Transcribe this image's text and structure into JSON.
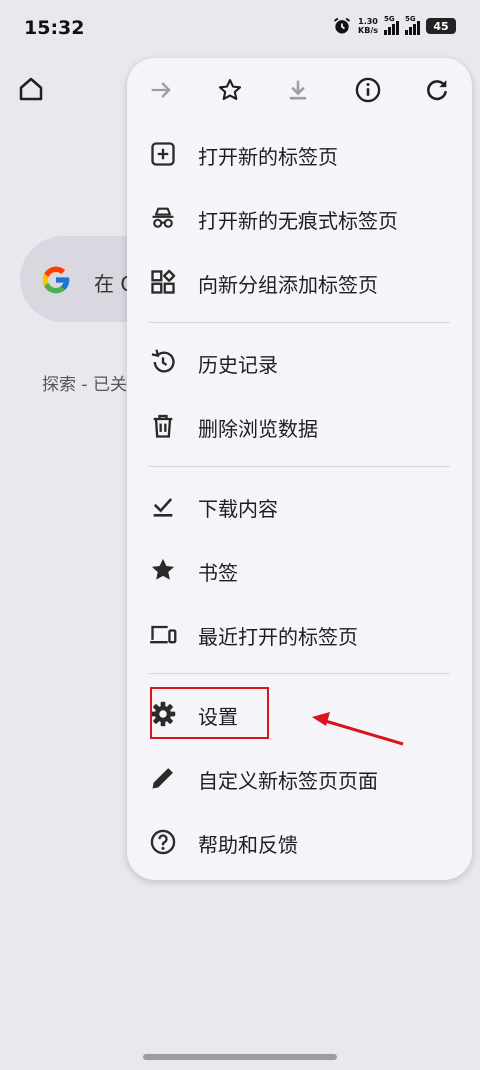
{
  "status_bar": {
    "time": "15:32",
    "speed_value": "1.30",
    "speed_unit": "KB/s",
    "sim1_type": "5G",
    "sim2_type": "5G",
    "battery": "45"
  },
  "page": {
    "search_text": "在 G",
    "feed_label": "探索 - 已关"
  },
  "menu": {
    "toolbar": {
      "forward_icon": "arrow-forward-icon",
      "bookmark_icon": "star-outline-icon",
      "download_icon": "download-icon",
      "info_icon": "info-icon",
      "refresh_icon": "refresh-icon"
    },
    "items": [
      {
        "label": "打开新的标签页",
        "icon": "new-tab-icon"
      },
      {
        "label": "打开新的无痕式标签页",
        "icon": "incognito-icon"
      },
      {
        "label": "向新分组添加标签页",
        "icon": "tab-group-icon"
      },
      {
        "label": "历史记录",
        "icon": "history-icon"
      },
      {
        "label": "删除浏览数据",
        "icon": "trash-icon"
      },
      {
        "label": "下载内容",
        "icon": "download-done-icon"
      },
      {
        "label": "书签",
        "icon": "star-filled-icon"
      },
      {
        "label": "最近打开的标签页",
        "icon": "devices-icon"
      },
      {
        "label": "设置",
        "icon": "gear-icon"
      },
      {
        "label": "自定义新标签页页面",
        "icon": "pencil-icon"
      },
      {
        "label": "帮助和反馈",
        "icon": "help-icon"
      }
    ]
  },
  "annotation": {
    "highlight_color": "#d8141c"
  }
}
